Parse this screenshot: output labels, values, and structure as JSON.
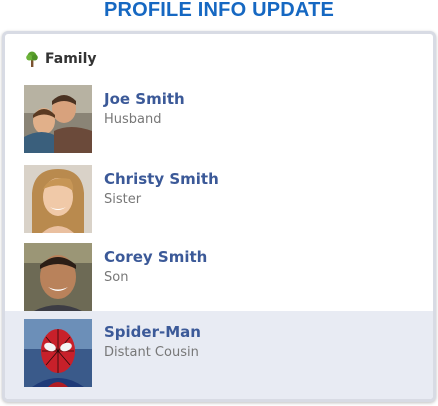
{
  "page": {
    "title": "PROFILE INFO UPDATE"
  },
  "section": {
    "label": "Family",
    "icon": "tree-icon"
  },
  "members": [
    {
      "name": "Joe Smith",
      "relation": "Husband",
      "photo": "avatar-photo"
    },
    {
      "name": "Christy Smith",
      "relation": "Sister",
      "photo": "avatar-photo"
    },
    {
      "name": "Corey Smith",
      "relation": "Son",
      "photo": "avatar-photo"
    },
    {
      "name": "Spider-Man",
      "relation": "Distant Cousin",
      "photo": "avatar-photo",
      "selected": true
    }
  ],
  "colors": {
    "title": "#1668c2",
    "name_link": "#3b5998",
    "relation_text": "#777777",
    "selected_row": "#e8ebf3"
  }
}
